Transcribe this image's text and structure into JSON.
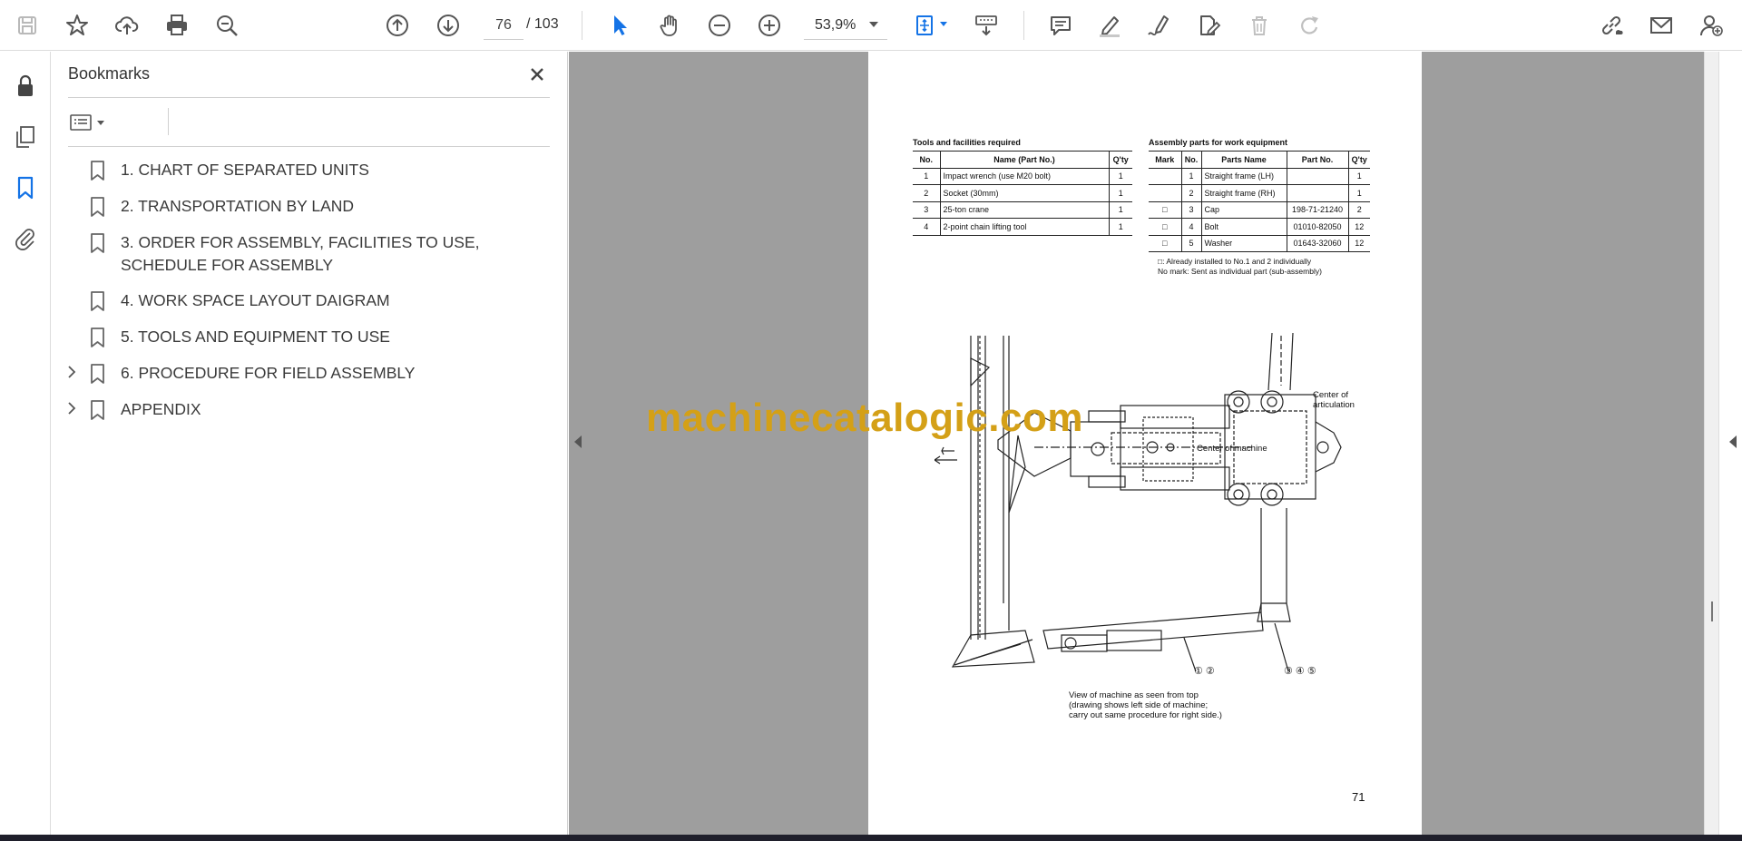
{
  "toolbar": {
    "current_page": "76",
    "total_pages": "/  103",
    "zoom": "53,9%"
  },
  "bookmarks_panel": {
    "title": "Bookmarks",
    "items": [
      {
        "label": "1. CHART OF SEPARATED UNITS",
        "expandable": false
      },
      {
        "label": "2. TRANSPORTATION BY LAND",
        "expandable": false
      },
      {
        "label": "3. ORDER FOR ASSEMBLY, FACILITIES TO USE, SCHEDULE FOR ASSEMBLY",
        "expandable": false
      },
      {
        "label": "4. WORK SPACE LAYOUT DAIGRAM",
        "expandable": false
      },
      {
        "label": "5. TOOLS AND EQUIPMENT TO USE",
        "expandable": false
      },
      {
        "label": "6. PROCEDURE FOR FIELD ASSEMBLY",
        "expandable": true
      },
      {
        "label": "APPENDIX",
        "expandable": true
      }
    ]
  },
  "document": {
    "tools_table": {
      "caption": "Tools and facilities required",
      "headers": [
        "No.",
        "Name (Part No.)",
        "Q'ty"
      ],
      "rows": [
        [
          "1",
          "Impact wrench (use M20 bolt)",
          "1"
        ],
        [
          "2",
          "Socket (30mm)",
          "1"
        ],
        [
          "3",
          "25-ton crane",
          "1"
        ],
        [
          "4",
          "2-point chain lifting tool",
          "1"
        ]
      ]
    },
    "parts_table": {
      "caption": "Assembly parts for work equipment",
      "headers": [
        "Mark",
        "No.",
        "Parts Name",
        "Part No.",
        "Q'ty"
      ],
      "rows": [
        [
          "",
          "1",
          "Straight frame (LH)",
          "",
          "1"
        ],
        [
          "",
          "2",
          "Straight frame (RH)",
          "",
          "1"
        ],
        [
          "□",
          "3",
          "Cap",
          "198-71-21240",
          "2"
        ],
        [
          "□",
          "4",
          "Bolt",
          "01010-82050",
          "12"
        ],
        [
          "□",
          "5",
          "Washer",
          "01643-32060",
          "12"
        ]
      ]
    },
    "notes": [
      "□: Already installed to No.1 and 2 individually",
      "No mark:  Sent as individual part (sub-assembly)"
    ],
    "drawing_labels": {
      "articulation": "Center of\narticulation",
      "machine_center": "Center of machine",
      "callout_a": "① ②",
      "callout_b": "③ ④ ⑤"
    },
    "caption": "View of machine as seen from top\n(drawing shows left side of machine;\ncarry out same procedure for right side.)",
    "page_number": "71"
  },
  "watermark": "machinecatalogic.com"
}
